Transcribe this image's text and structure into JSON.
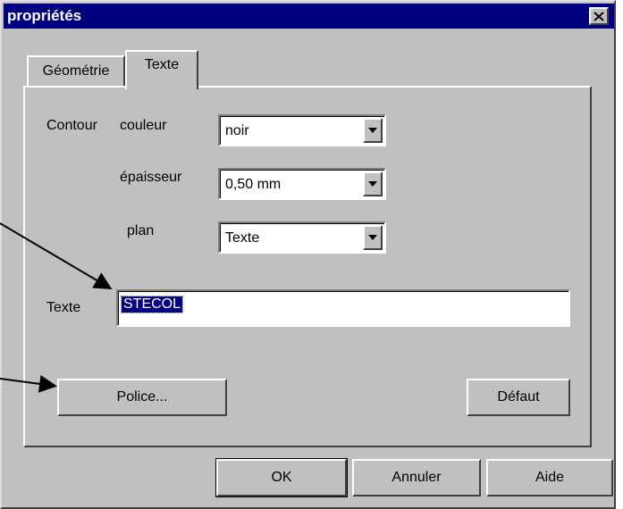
{
  "window": {
    "title": "propriétés",
    "close_icon": "close-icon"
  },
  "tabs": [
    {
      "label": "Géométrie",
      "active": false
    },
    {
      "label": "Texte",
      "active": true
    }
  ],
  "contour": {
    "label": "Contour",
    "couleur": {
      "label": "couleur",
      "value": "noir"
    },
    "epaisseur": {
      "label": "épaisseur",
      "value": "0,50 mm"
    },
    "plan": {
      "label": "plan",
      "value": "Texte"
    }
  },
  "texte": {
    "label": "Texte",
    "value": "STECOL"
  },
  "buttons": {
    "police": "Police...",
    "defaut": "Défaut",
    "ok": "OK",
    "annuler": "Annuler",
    "aide": "Aide"
  },
  "colors": {
    "titlebar": "#000080",
    "face": "#c0c0c0",
    "selection": "#000080"
  },
  "annotations": {
    "arrow_count": 2
  }
}
